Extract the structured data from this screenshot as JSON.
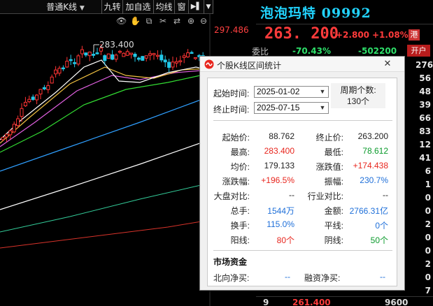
{
  "toolbar": {
    "items": [
      {
        "label": "普通K线"
      },
      {
        "label": "九转"
      },
      {
        "label": "加自选"
      },
      {
        "label": "均线"
      },
      {
        "label": "窗"
      }
    ],
    "more_arrow": "▶▌",
    "dropdown_arrow": "▼"
  },
  "icons": {
    "eye": "👁",
    "hand": "✋",
    "copy": "⧉",
    "scissors": "✂",
    "share": "⇄",
    "zoom_in": "⊕",
    "zoom_out": "⊖"
  },
  "chart": {
    "price_top_label": "297.486",
    "high_annotation": "283.400",
    "colors": {
      "up": "#ff3333",
      "down": "#22c8e8",
      "ma5": "#ffffff",
      "ma10": "#f0c040",
      "ma20": "#e060e0",
      "ma30": "#33dd33",
      "ma60": "#2f9fff",
      "ma120": "#ffffff",
      "ma250": "#33cc99"
    }
  },
  "quote": {
    "name": "泡泡玛特 09992",
    "price": "263. 200",
    "change": "+2.800",
    "change_pct": "+1.08%",
    "market_tag": "港",
    "row2_label": "委比",
    "ratio": "-70.43%",
    "ratio_diff": "-502200",
    "open_button": "开户",
    "side_numbers": [
      "276",
      "56",
      "48",
      "39",
      "66",
      "83",
      "12",
      "41",
      "6",
      "1",
      "0",
      "0",
      "2",
      "0",
      "0",
      "2",
      "0",
      "7"
    ],
    "bottom_left": "9",
    "bottom_price": "261.400",
    "bottom_vol": "9600"
  },
  "dialog": {
    "title": "个股K线区间统计",
    "close": "✕",
    "start_label": "起始时间:",
    "start_value": "2025-01-02",
    "end_label": "终止时间:",
    "end_value": "2025-07-15",
    "period_label": "周期个数:",
    "period_value": "130个",
    "stats": {
      "start_price_label": "起始价:",
      "start_price": "88.762",
      "end_price_label": "终止价:",
      "end_price": "263.200",
      "high_label": "最高:",
      "high": "283.400",
      "low_label": "最低:",
      "low": "78.612",
      "avg_label": "均价:",
      "avg": "179.133",
      "change_val_label": "涨跌值:",
      "change_val": "+174.438",
      "change_pct_label": "涨跌幅:",
      "change_pct": "+196.5%",
      "amp_label": "振幅:",
      "amp": "230.7%",
      "market_cmp_label": "大盘对比:",
      "market_cmp": "--",
      "industry_cmp_label": "行业对比:",
      "industry_cmp": "--",
      "volume_label": "总手:",
      "volume": "1544万",
      "amount_label": "金额:",
      "amount": "2766.31亿",
      "turnover_label": "换手:",
      "turnover": "115.0%",
      "flat_label": "平线:",
      "flat": "0个",
      "up_label": "阳线:",
      "up": "80个",
      "down_label": "阴线:",
      "down": "50个"
    },
    "capital": {
      "title": "市场资金",
      "north_label": "北向净买:",
      "north": "--",
      "margin_label": "融资净买:",
      "margin": "--"
    }
  }
}
